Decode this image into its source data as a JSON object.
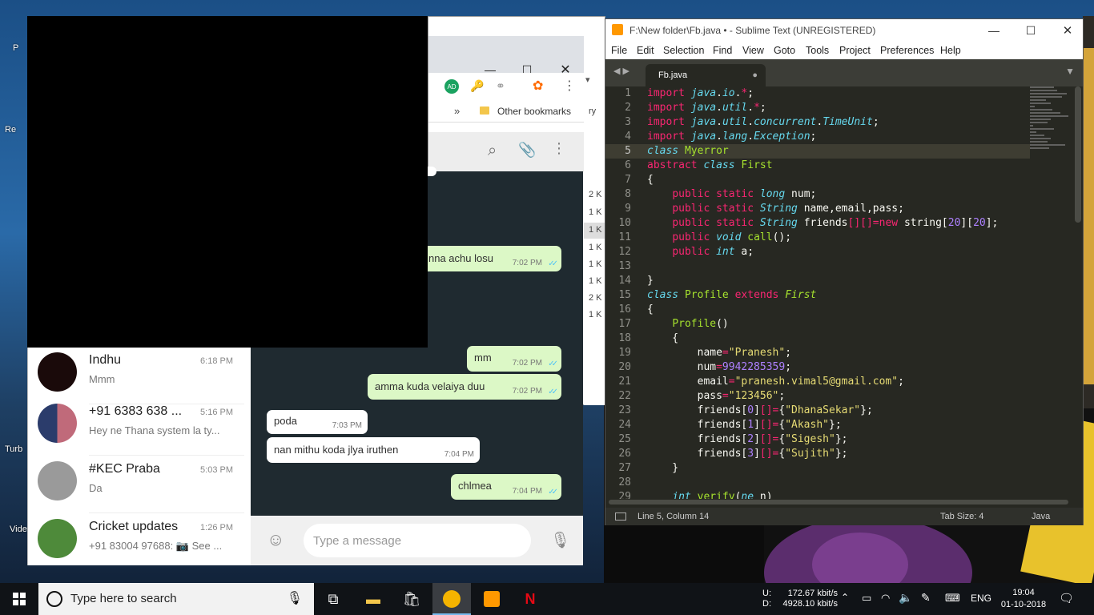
{
  "desktop": {
    "icons": [
      "P",
      "Re",
      "Turb",
      "Vide"
    ]
  },
  "browser": {
    "other_bookmarks": "Other bookmarks",
    "ext_badge": "AD",
    "more_chevron": "»",
    "right_list": [
      "2 K",
      "1 K",
      "1 K",
      "1 K",
      "1 K",
      "1 K",
      "2 K",
      "1 K"
    ],
    "right_fragment": "ry"
  },
  "chat": {
    "messages": [
      {
        "text": "nna achu losu",
        "time": "7:02 PM",
        "dir": "out"
      },
      {
        "text": "mm",
        "time": "7:02 PM",
        "dir": "out"
      },
      {
        "text": "amma kuda velaiya duu",
        "time": "7:02 PM",
        "dir": "out"
      },
      {
        "text": "poda",
        "time": "7:03 PM",
        "dir": "in"
      },
      {
        "text": "nan mithu koda jlya iruthen",
        "time": "7:04 PM",
        "dir": "in"
      },
      {
        "text": "chlmea",
        "time": "7:04 PM",
        "dir": "out"
      }
    ],
    "composer_placeholder": "Type a message"
  },
  "chat_list": [
    {
      "name": "Indhu",
      "preview": "Mmm",
      "time": "6:18 PM"
    },
    {
      "name": "+91 6383 638 ...",
      "preview": "Hey ne Thana system la ty...",
      "time": "5:16 PM"
    },
    {
      "name": "#KEC Praba",
      "preview": "Da",
      "time": "5:03 PM"
    },
    {
      "name": "Cricket updates",
      "preview": "+91 83004 97688: 📷 See ...",
      "time": "1:26 PM"
    }
  ],
  "sublime": {
    "title": "F:\\New folder\\Fb.java • - Sublime Text (UNREGISTERED)",
    "menu": [
      "File",
      "Edit",
      "Selection",
      "Find",
      "View",
      "Goto",
      "Tools",
      "Project",
      "Preferences",
      "Help"
    ],
    "tab_name": "Fb.java",
    "tab_dot": "●",
    "status_position": "Line 5, Column 14",
    "status_tab_size": "Tab Size: 4",
    "status_syntax": "Java",
    "current_line": 5
  },
  "taskbar": {
    "search_placeholder": "Type here to search",
    "net_up_label": "U:",
    "net_down_label": "D:",
    "net_up": "172.67 kbit/s",
    "net_down": "4928.10 kbit/s",
    "language": "ENG",
    "time": "19:04",
    "date": "01-10-2018"
  },
  "colors": {
    "whatsapp_out": "#dcf8c6",
    "sublime_bg": "#272822",
    "taskbar": "#101317"
  }
}
